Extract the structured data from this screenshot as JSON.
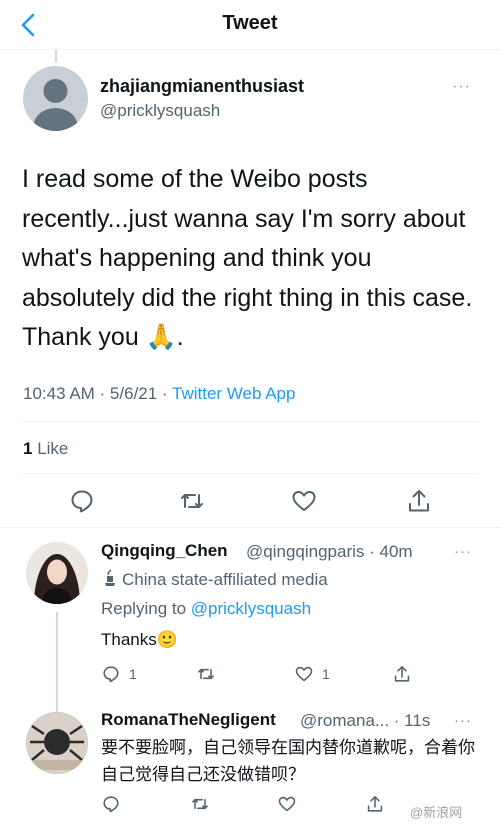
{
  "header": {
    "title": "Tweet"
  },
  "tweet": {
    "author_name": "zhajiangmianenthusiast",
    "author_handle": "@pricklysquash",
    "more": "···",
    "text": "I read some of the Weibo posts recently...just wanna say I'm sorry about what's happening and think you absolutely did the right thing in this case. Thank you 🙏.",
    "time": "10:43 AM · 5/6/21 · ",
    "source": "Twitter Web App",
    "like_count": "1",
    "like_label": "Like"
  },
  "reply1": {
    "name": "Qingqing_Chen",
    "handle": "@qingqingparis · 40m",
    "more": "···",
    "state_label": "China state-affiliated media",
    "replying_prefix": "Replying to ",
    "replying_to": "@pricklysquash",
    "text": "Thanks🙂",
    "reply_count": "1",
    "like_count": "1"
  },
  "reply2": {
    "name": "RomanaTheNegligent",
    "handle": "@romana... · 11s",
    "more": "···",
    "text": "要不要脸啊，自己领导在国内替你道歉呢，合着你自己觉得自己还没做错呗？"
  },
  "watermark": "@新浪网"
}
